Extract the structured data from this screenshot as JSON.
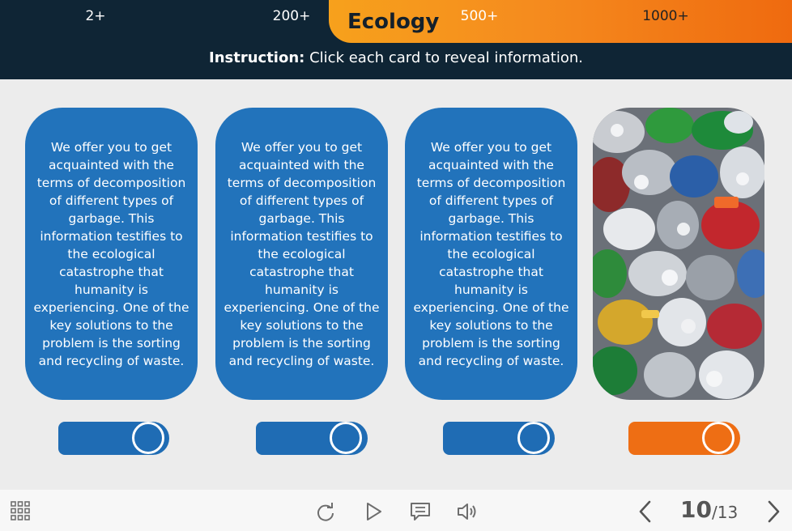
{
  "header": {
    "title": "Ecology",
    "instruction_label": "Instruction:",
    "instruction_text": " Click each card to reveal information."
  },
  "cards": [
    {
      "text": "We offer you to get acquainted with the terms of decomposition of different types of garbage. This information testifies to the ecological catastrophe that humanity is experiencing. One of the key solutions to the problem is the sorting and recycling of waste."
    },
    {
      "text": "We offer you to get acquainted with the terms of decomposition of different types of garbage. This information testifies to the ecological catastrophe that humanity is experiencing. One of the key solutions to the problem is the sorting and recycling of waste."
    },
    {
      "text": "We offer you to get acquainted with the terms of decomposition of different types of garbage. This information testifies to the ecological catastrophe that humanity is experiencing. One of the key solutions to the problem is the sorting and recycling of waste."
    },
    {
      "image": "crushed-cans-photo"
    }
  ],
  "toggles": [
    {
      "label": "2+",
      "color": "#1f6cb4"
    },
    {
      "label": "200+",
      "color": "#1f6cb4"
    },
    {
      "label": "500+",
      "color": "#1f6cb4"
    },
    {
      "label": "1000+",
      "color": "#ee6e14"
    }
  ],
  "footer": {
    "menu_icon": "grid-menu-icon",
    "replay_icon": "replay-icon",
    "play_icon": "play-icon",
    "notes_icon": "notes-icon",
    "volume_icon": "volume-icon",
    "current_page": "10",
    "total_pages": "/13"
  },
  "colors": {
    "header_bg": "#0f2535",
    "title_accent": "#f58b1e",
    "card_blue": "#2273bb",
    "active_orange": "#ee6e14"
  }
}
